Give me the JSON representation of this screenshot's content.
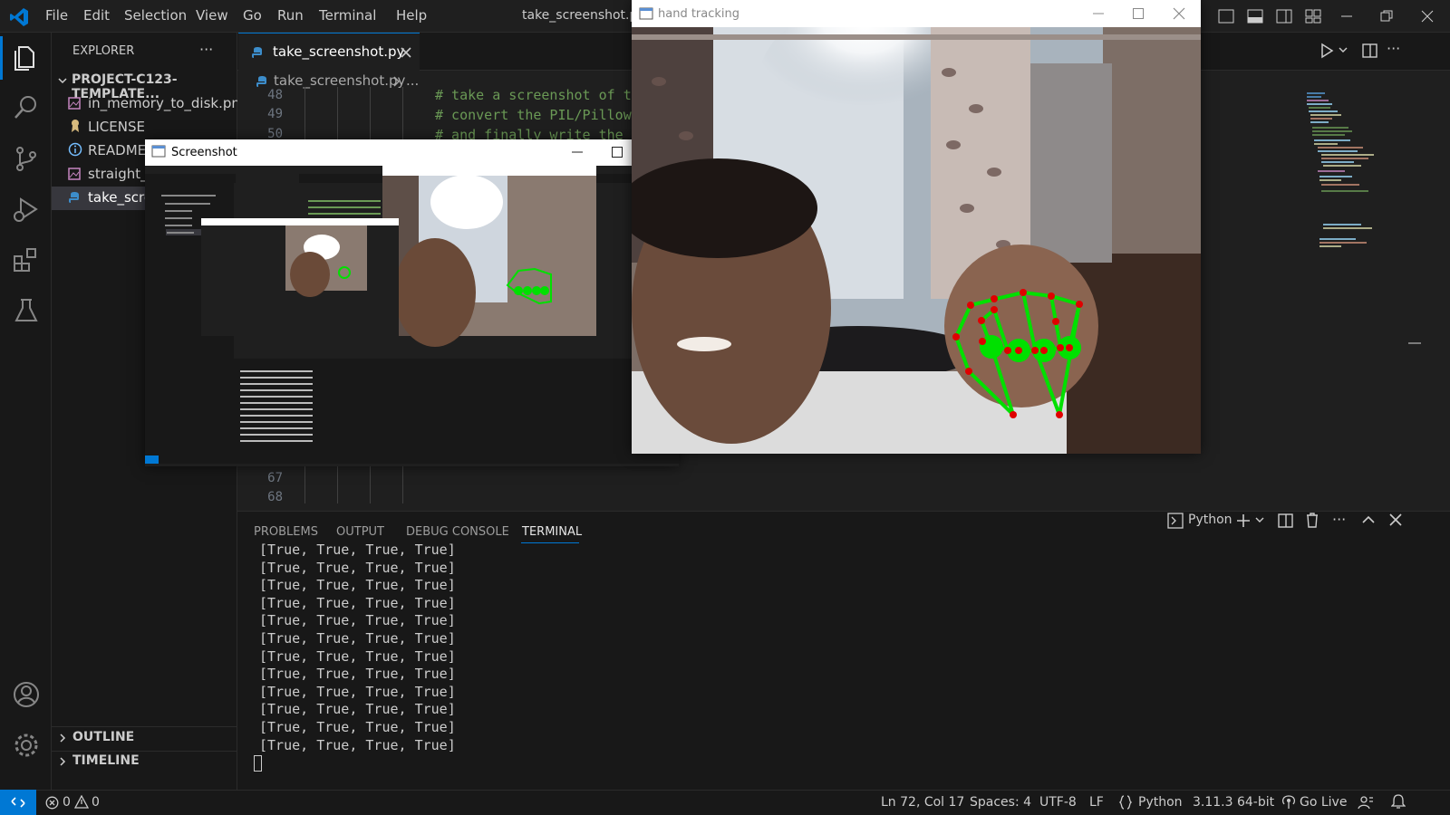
{
  "menu": [
    "File",
    "Edit",
    "Selection",
    "View",
    "Go",
    "Run",
    "Terminal",
    "Help"
  ],
  "window_title": "take_screenshot.py -",
  "sidebar": {
    "header": "EXPLORER",
    "more": "···",
    "project": "PROJECT-C123-TEMPLATE...",
    "files": [
      "in_memory_to_disk.png",
      "LICENSE",
      "README.",
      "straight_t",
      "take_scre"
    ],
    "outline": "OUTLINE",
    "timeline": "TIMELINE"
  },
  "editor": {
    "tab": "take_screenshot.py",
    "breadcrumb": "take_screenshot.py",
    "breadcrumb_more": "...",
    "line_numbers": [
      "48",
      "49",
      "50",
      "67",
      "68"
    ],
    "code_lines": [
      "# take a screenshot of t",
      "# convert the PIL/Pillow",
      "# and finally write the"
    ]
  },
  "panel": {
    "tabs": [
      "PROBLEMS",
      "OUTPUT",
      "DEBUG CONSOLE",
      "TERMINAL"
    ],
    "active_tab": "TERMINAL",
    "shell": "Python",
    "lines": [
      "[True, True, True, True]",
      "[True, True, True, True]",
      "[True, True, True, True]",
      "[True, True, True, True]",
      "[True, True, True, True]",
      "[True, True, True, True]",
      "[True, True, True, True]",
      "[True, True, True, True]",
      "[True, True, True, True]",
      "[True, True, True, True]",
      "[True, True, True, True]",
      "[True, True, True, True]"
    ]
  },
  "status": {
    "errors": "0",
    "warnings": "0",
    "position": "Ln 72, Col 17",
    "spaces": "Spaces: 4",
    "encoding": "UTF-8",
    "eol": "LF",
    "language": "Python",
    "interpreter": "3.11.3 64-bit",
    "golive": "Go Live"
  },
  "hand_window": {
    "title": "hand tracking"
  },
  "screenshot_window": {
    "title": "Screenshot"
  },
  "colors": {
    "accent": "#0078d4",
    "landmark_green": "#00e000",
    "landmark_red": "#e00000"
  }
}
